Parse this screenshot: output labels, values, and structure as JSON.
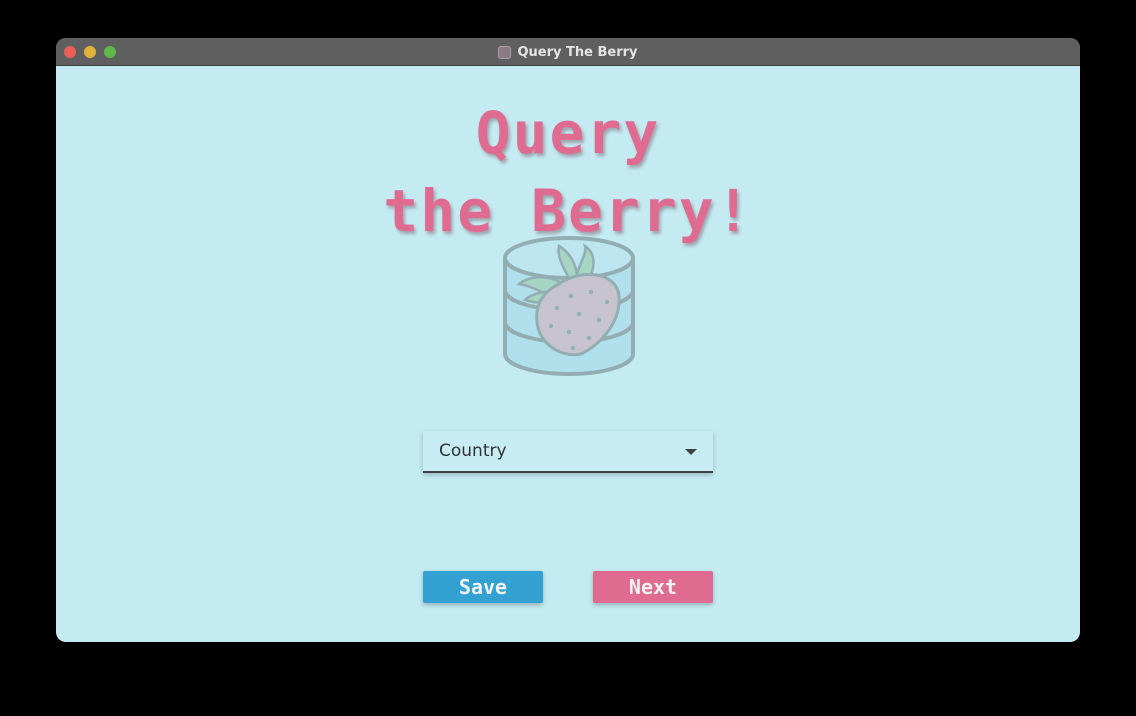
{
  "window": {
    "title": "Query The Berry"
  },
  "heading": {
    "line1": "Query",
    "line2": "the Berry!"
  },
  "logo": {
    "icon": "strawberry-database-icon"
  },
  "dropdown": {
    "selected": "Country"
  },
  "buttons": {
    "save_label": "Save",
    "next_label": "Next"
  },
  "colors": {
    "background": "#c4ebf2",
    "titlebar": "#5f5f5f",
    "accent_pink": "#e06b91",
    "accent_blue": "#33a2d2"
  }
}
